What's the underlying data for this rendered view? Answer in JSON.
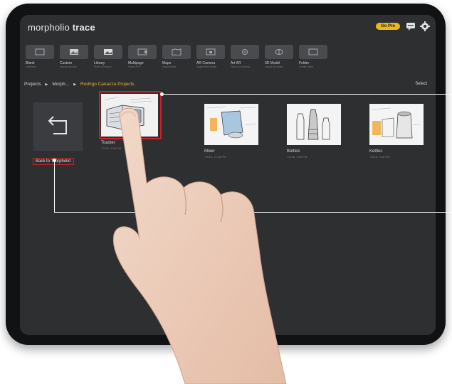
{
  "app": {
    "logo_part1": "morpholio",
    "logo_part2": "trace",
    "go_pro": "Go Pro"
  },
  "toolbar": [
    {
      "label": "Blank",
      "sub": "Unlimited"
    },
    {
      "label": "Custom",
      "sub": "Import any size"
    },
    {
      "label": "Library",
      "sub": "Photo Inventory"
    },
    {
      "label": "Multipage",
      "sub": "Import PDF"
    },
    {
      "label": "Maps",
      "sub": "Import Maps"
    },
    {
      "label": "AR Camera",
      "sub": "Augmented reality"
    },
    {
      "label": "Art AR",
      "sub": "Trace via camera"
    },
    {
      "label": "3D Model",
      "sub": "Import 3D model"
    },
    {
      "label": "Folder",
      "sub": "Create folder"
    }
  ],
  "breadcrumb": {
    "root": "Projects",
    "middle": "Morph...",
    "current": "Rodrigo Canazza Projects"
  },
  "select_label": "Select",
  "back": {
    "label": "Back to 'Morpholio'"
  },
  "projects": [
    {
      "name": "Toaster",
      "date": "7/5/18, 3:58 PM"
    },
    {
      "name": "Mixer",
      "date": "7/5/18, 12:38 PM"
    },
    {
      "name": "Bottles",
      "date": "7/5/18, 3:53 PM"
    },
    {
      "name": "Kettles",
      "date": "7/5/18, 3:38 PM"
    }
  ],
  "colors": {
    "highlight": "#d11f26",
    "accent": "#e7b530",
    "screen": "#2e2f31"
  }
}
